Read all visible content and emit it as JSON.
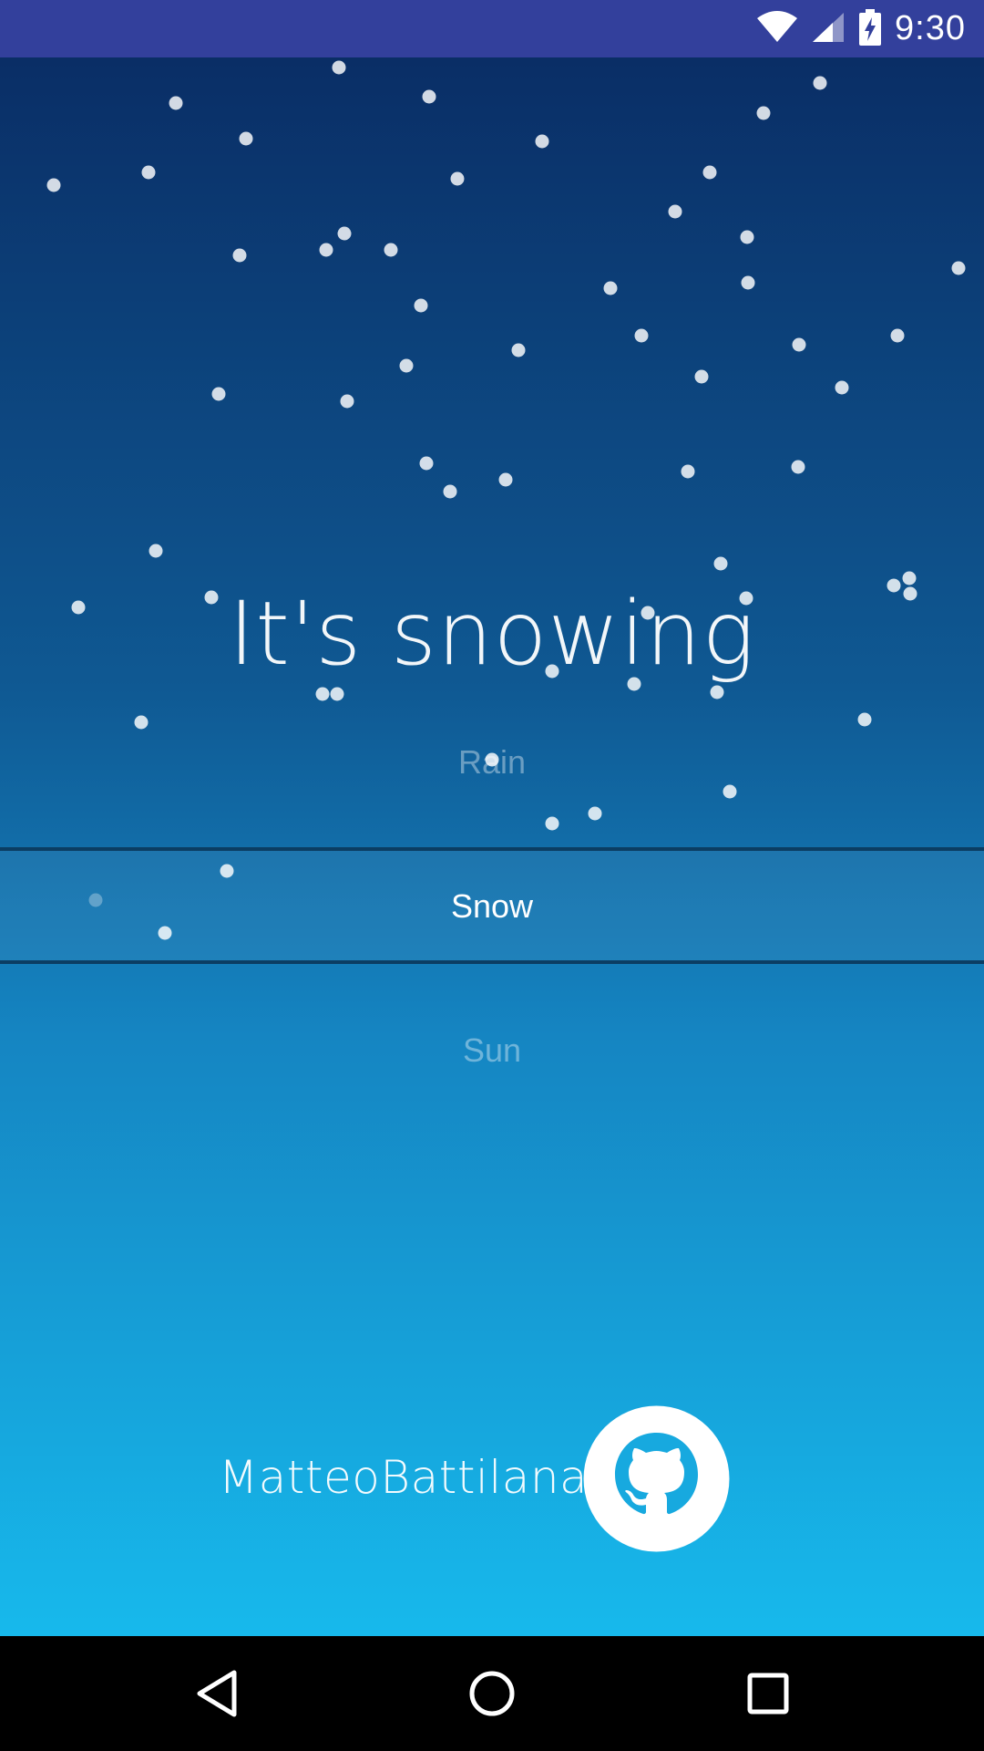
{
  "status_bar": {
    "time": "9:30",
    "color": "#33409c",
    "icons": [
      "wifi-icon",
      "cell-signal-icon",
      "battery-charging-icon"
    ]
  },
  "main": {
    "heading": "It's snowing",
    "background_gradient": [
      "#0a2e66",
      "#0f5993",
      "#1585c2",
      "#17b9ec"
    ]
  },
  "picker": {
    "items": [
      {
        "label": "Rain",
        "selected": false
      },
      {
        "label": "Snow",
        "selected": true
      },
      {
        "label": "Sun",
        "selected": false
      }
    ]
  },
  "footer": {
    "author": "MatteoBattilana",
    "logo_icon": "github-icon"
  },
  "nav_bar": {
    "buttons": [
      "back-icon",
      "home-icon",
      "recents-icon"
    ]
  }
}
